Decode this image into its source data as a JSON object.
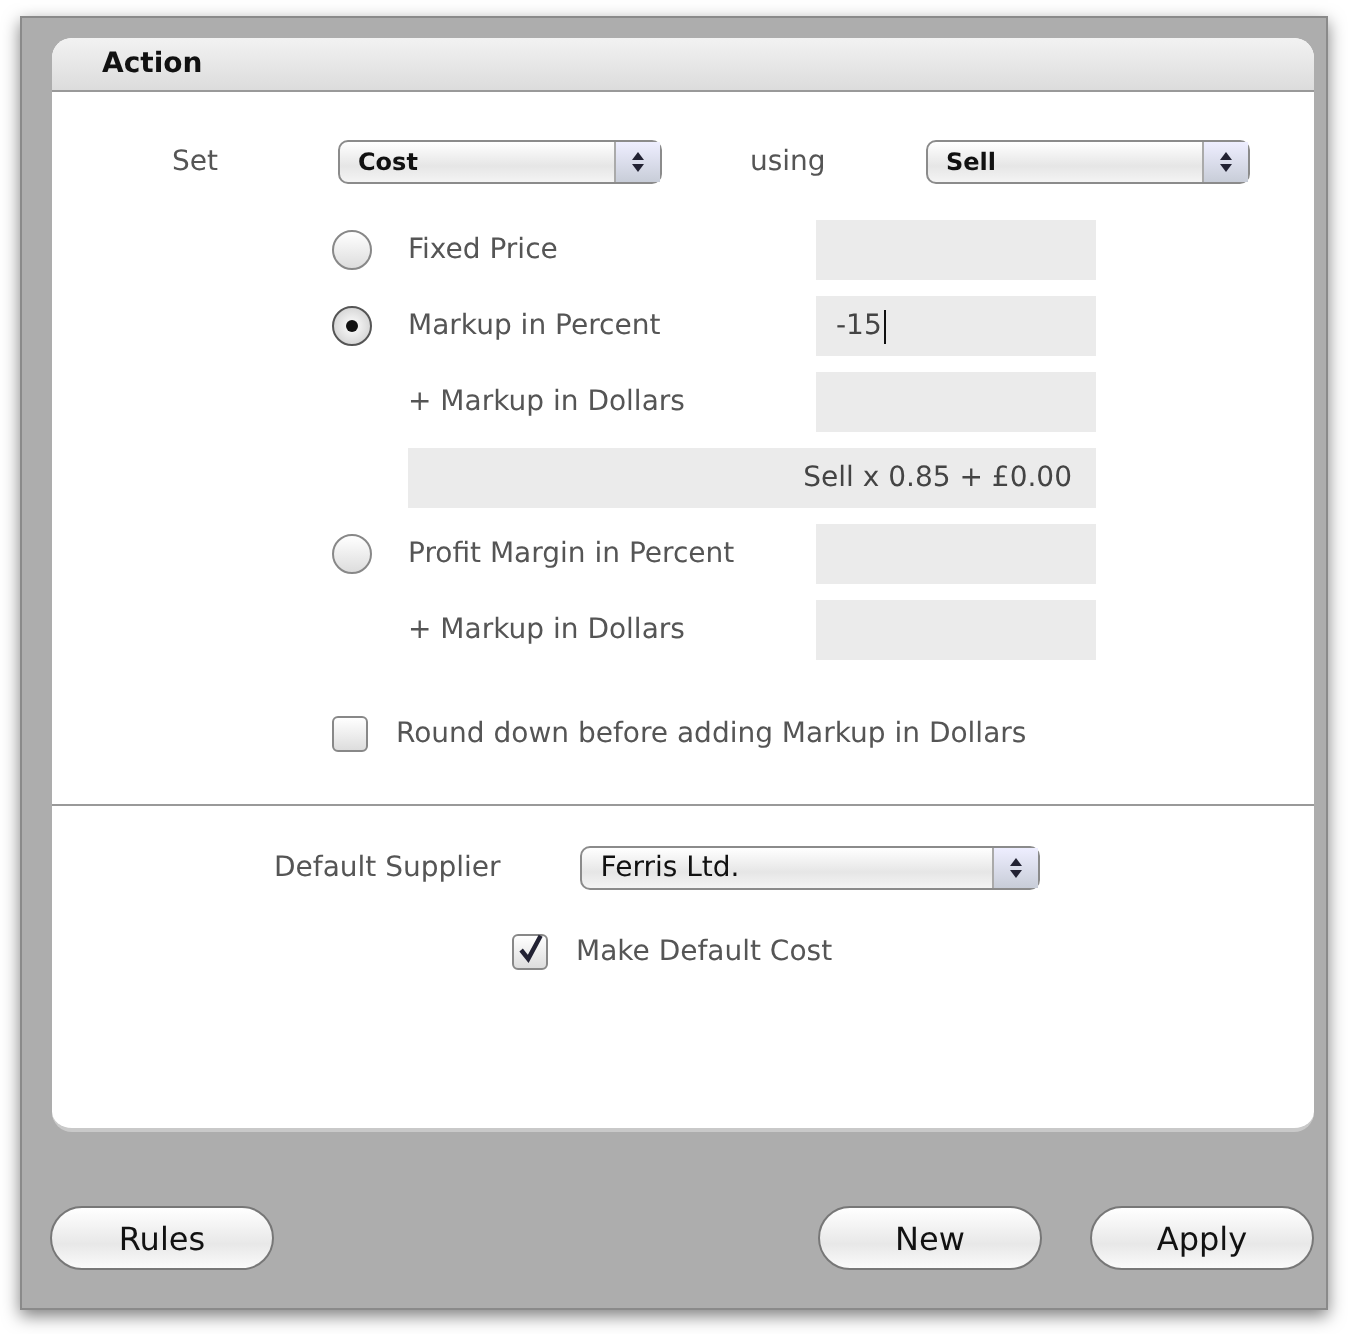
{
  "panel": {
    "title": "Action"
  },
  "set_row": {
    "label": "Set",
    "target": "Cost",
    "using_label": "using",
    "source": "Sell"
  },
  "rows": [
    {
      "kind": "radio",
      "label": "Fixed Price",
      "selected": false
    },
    {
      "kind": "radio",
      "label": "Markup in Percent",
      "selected": true,
      "value": "-15",
      "focused": true
    },
    {
      "kind": "sub",
      "label": "+ Markup in Dollars"
    },
    {
      "kind": "formula",
      "text": "Sell x 0.85 + £0.00"
    },
    {
      "kind": "radio",
      "label": "Profit Margin in Percent",
      "selected": false
    },
    {
      "kind": "sub",
      "label": "+ Markup in Dollars"
    },
    {
      "kind": "checkbox",
      "label": "Round down before adding Markup in Dollars",
      "checked": false
    }
  ],
  "supplier": {
    "label": "Default Supplier",
    "value": "Ferris Ltd.",
    "make_default": {
      "label": "Make Default Cost",
      "checked": true
    }
  },
  "buttons": {
    "left": [
      "Rules"
    ],
    "right": [
      "New",
      "Apply"
    ]
  }
}
